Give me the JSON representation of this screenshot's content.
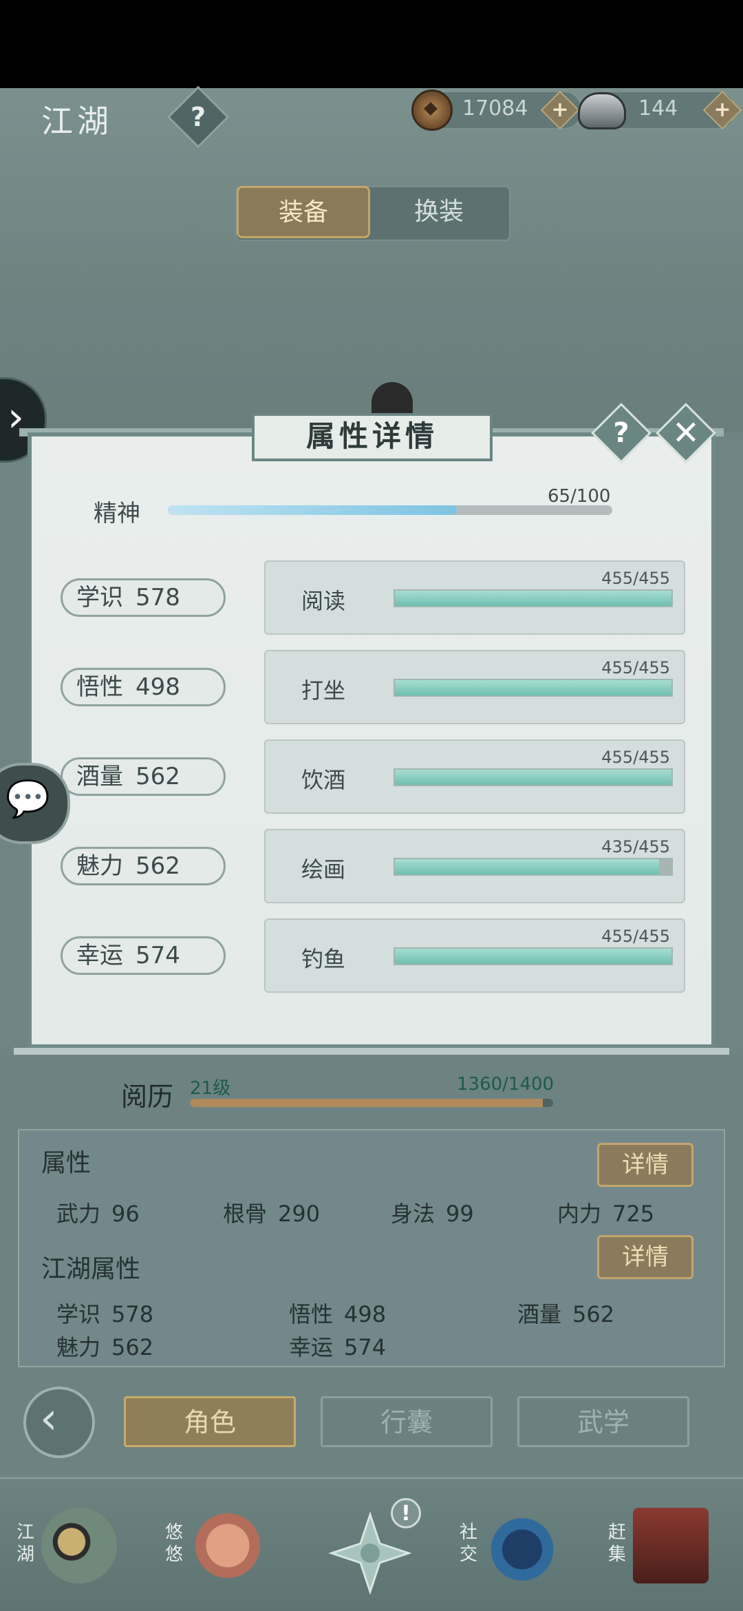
{
  "header": {
    "title": "江湖",
    "help_label": "?",
    "coins": "17084",
    "ingots": "144",
    "plus": "+"
  },
  "tabs": {
    "equip": "装备",
    "swap": "换装"
  },
  "side": {
    "arrow": "›",
    "chat": "💬"
  },
  "modal": {
    "title": "属性详情",
    "help": "?",
    "close": "✕",
    "spirit": {
      "label": "精神",
      "value": "65/100",
      "fraction": 0.65
    },
    "stats": [
      {
        "label": "学识",
        "value": "578",
        "skill": "阅读",
        "skill_value": "455/455",
        "fraction": 1.0
      },
      {
        "label": "悟性",
        "value": "498",
        "skill": "打坐",
        "skill_value": "455/455",
        "fraction": 1.0
      },
      {
        "label": "酒量",
        "value": "562",
        "skill": "饮酒",
        "skill_value": "455/455",
        "fraction": 1.0
      },
      {
        "label": "魅力",
        "value": "562",
        "skill": "绘画",
        "skill_value": "435/455",
        "fraction": 0.956
      },
      {
        "label": "幸运",
        "value": "574",
        "skill": "钓鱼",
        "skill_value": "455/455",
        "fraction": 1.0
      }
    ]
  },
  "experience": {
    "label": "阅历",
    "level": "21级",
    "value": "1360/1400",
    "fraction": 0.971
  },
  "attributes": {
    "title": "属性",
    "detail": "详情",
    "items": [
      {
        "label": "武力",
        "value": "96"
      },
      {
        "label": "根骨",
        "value": "290"
      },
      {
        "label": "身法",
        "value": "99"
      },
      {
        "label": "内力",
        "value": "725"
      }
    ]
  },
  "jianghu_attributes": {
    "title": "江湖属性",
    "detail": "详情",
    "items": [
      {
        "label": "学识",
        "value": "578"
      },
      {
        "label": "悟性",
        "value": "498"
      },
      {
        "label": "酒量",
        "value": "562"
      },
      {
        "label": "魅力",
        "value": "562"
      },
      {
        "label": "幸运",
        "value": "574"
      }
    ]
  },
  "nav": {
    "back": "‹",
    "role": "角色",
    "bag": "行囊",
    "martial": "武学"
  },
  "dock": {
    "jianghu": "江湖",
    "youyou": "悠悠",
    "badge": "!",
    "social": "社交",
    "market": "赶集"
  },
  "colors": {
    "background": "#6f8583",
    "modal": "#e6ecea",
    "accent_gold": "#8a7b5c",
    "bar_teal": "#6fbfb0",
    "bar_blue": "#7cc4e2"
  }
}
